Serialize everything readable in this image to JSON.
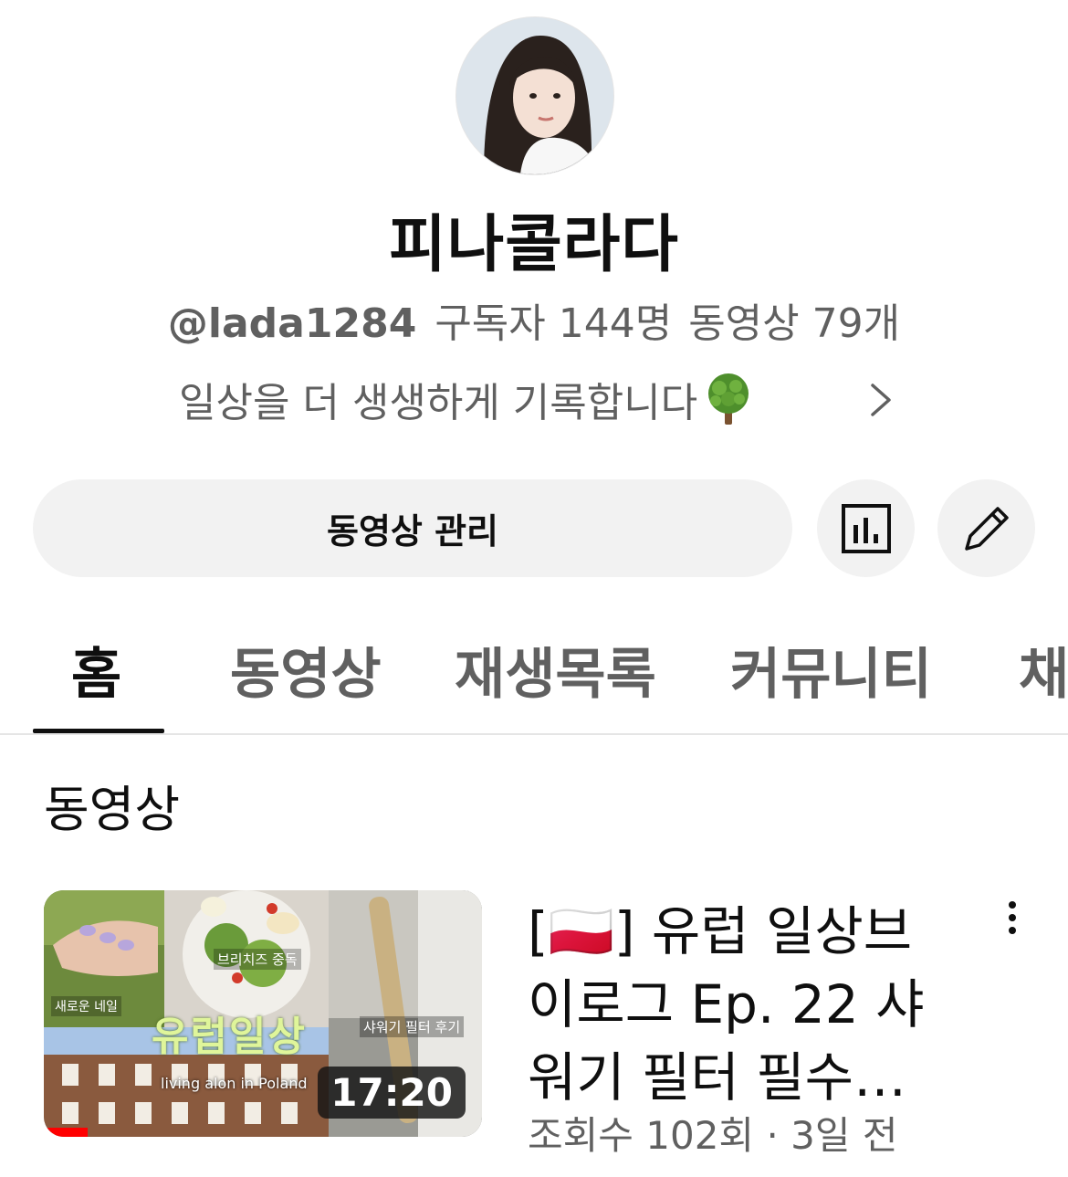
{
  "channel": {
    "name": "피나콜라다",
    "handle": "@lada1284",
    "subscribers": "구독자 144명",
    "videos_count": "동영상 79개",
    "description": "일상을 더 생생하게 기록합니다",
    "description_emoji": "🌳"
  },
  "actions": {
    "manage_videos": "동영상 관리"
  },
  "tabs": [
    {
      "label": "홈",
      "active": true
    },
    {
      "label": "동영상"
    },
    {
      "label": "재생목록"
    },
    {
      "label": "커뮤니티"
    },
    {
      "label": "채"
    }
  ],
  "section": {
    "title": "동영상"
  },
  "video": {
    "title": "[🇵🇱] 유럽 일상브이로그 Ep. 22 샤워기 필터 필수…",
    "views": "조회수 102회",
    "separator": "·",
    "age": "3일 전",
    "duration": "17:20",
    "progress_fraction": 0.1,
    "thumb_texts": {
      "left_label": "새로운 네일",
      "center_label": "브리치즈 중독",
      "right_label": "샤워기 필터 후기",
      "title_overlay": "유럽일상",
      "caption": "living alon in Poland"
    }
  },
  "colors": {
    "primary_text": "#0f0f0f",
    "secondary_text": "#606060",
    "button_bg": "#f2f2f2",
    "progress": "#ff0000"
  },
  "icons": {
    "analytics": "bar-chart-icon",
    "edit": "pencil-icon",
    "chevron": "chevron-right-icon",
    "more": "more-vertical-icon"
  }
}
